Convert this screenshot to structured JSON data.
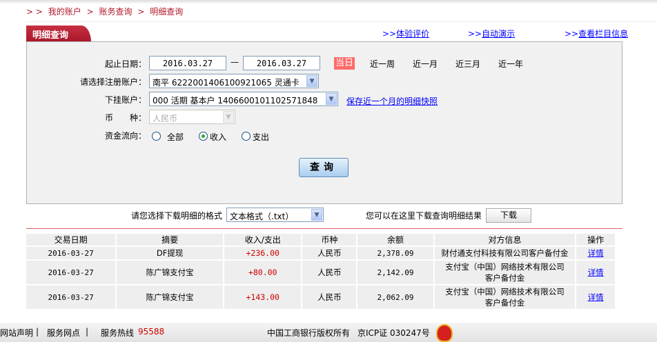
{
  "breadcrumb": {
    "prefix": "> >",
    "items": [
      "我的账户",
      "账务查询",
      "明细查询"
    ],
    "sep": ">"
  },
  "tab": {
    "title": "明细查询"
  },
  "top_links": [
    {
      "arrow": ">>",
      "label": "体验评价"
    },
    {
      "arrow": ">>",
      "label": "自动演示"
    },
    {
      "arrow": ">>",
      "label": "查看栏目信息"
    }
  ],
  "form": {
    "date_label": "起止日期：",
    "start_date": "2016.03.27",
    "dash": "—",
    "end_date": "2016.03.27",
    "quick_ranges": [
      "当日",
      "近一周",
      "近一月",
      "近三月",
      "近一年"
    ],
    "active_range": "当日",
    "account_label": "请选择注册账户：",
    "account_value": "南平 6222001406100921065 灵通卡",
    "sub_account_label": "下挂账户：",
    "sub_account_value": "000 活期 基本户 1406600101102571848",
    "snapshot_link": "保存近一个月的明细快照",
    "currency_label": "币　　种：",
    "currency_value": "人民币",
    "flow_label": "资金流向：",
    "flow_options": [
      "全部",
      "收入",
      "支出"
    ],
    "flow_selected": "收入",
    "query_button": "查询"
  },
  "download": {
    "format_label": "请您选择下载明细的格式",
    "format_value": "文本格式（.txt）",
    "hint": "您可以在这里下载查询明细结果",
    "button": "下载"
  },
  "table": {
    "headers": [
      "交易日期",
      "摘要",
      "收入/支出",
      "币种",
      "余额",
      "对方信息",
      "操作"
    ],
    "rows": [
      {
        "date": "2016-03-27",
        "summary": "DF提现",
        "amount": "+236.00",
        "currency": "人民币",
        "balance": "2,378.09",
        "counterparty": "财付通支付科技有限公司客户备付金",
        "action": "详情"
      },
      {
        "date": "2016-03-27",
        "summary": "陈广锦支付宝",
        "amount": "+80.00",
        "currency": "人民币",
        "balance": "2,142.09",
        "counterparty": "支付宝（中国）网络技术有限公司客户备付金",
        "action": "详情"
      },
      {
        "date": "2016-03-27",
        "summary": "陈广锦支付宝",
        "amount": "+143.00",
        "currency": "人民币",
        "balance": "2,062.09",
        "counterparty": "支付宝（中国）网络技术有限公司客户备付金",
        "action": "详情"
      }
    ]
  },
  "footer": {
    "links": [
      "网站声明",
      "服务网点"
    ],
    "sep": "|",
    "hotline_label": "服务热线",
    "hotline": "95588",
    "copyright": "中国工商银行版权所有",
    "icp": "京ICP证 030247号",
    "hotline_color": "#cc0000"
  }
}
